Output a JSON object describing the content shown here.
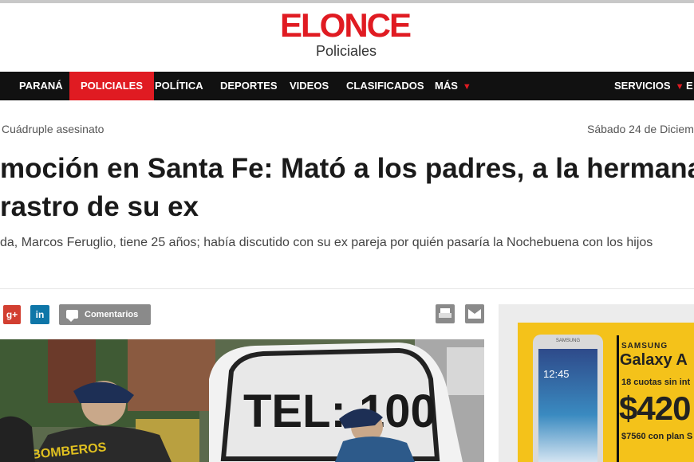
{
  "site": {
    "logo": "ELONCE",
    "section": "Policiales"
  },
  "nav": {
    "items": [
      "PARANÁ",
      "POLICIALES",
      "POLÍTICA",
      "DEPORTES",
      "VIDEOS",
      "CLASIFICADOS",
      "MÁS"
    ],
    "right": "SERVICIOS",
    "right_extra": "E"
  },
  "article": {
    "breadcrumb": "Cuádruple asesinato",
    "date": "Sábado 24 de Diciem",
    "headline_line1": "moción en Santa Fe: Mató a los padres, a la hermana",
    "headline_line2": "rastro de su ex",
    "summary": "da, Marcos Feruglio, tiene 25 años; había discutido con su ex pareja por quién pasaría la Nochebuena con los hijos",
    "comments_label": "Comentarios",
    "gplus_label": "g+",
    "linkedin_label": "in",
    "photo_truck_text": "TEL: 100",
    "photo_shirt_text": "BOMBEROS"
  },
  "ad": {
    "phone_brand": "SAMSUNG",
    "phone_clock": "12:45",
    "brand": "SAMSUNG",
    "model": "Galaxy A",
    "cuotas": "18 cuotas sin int",
    "price": "$420",
    "plan": "$7560 con plan S"
  },
  "colors": {
    "brand_red": "#e01b22",
    "nav_bg": "#111111",
    "ad_yellow": "#f4c21a"
  }
}
